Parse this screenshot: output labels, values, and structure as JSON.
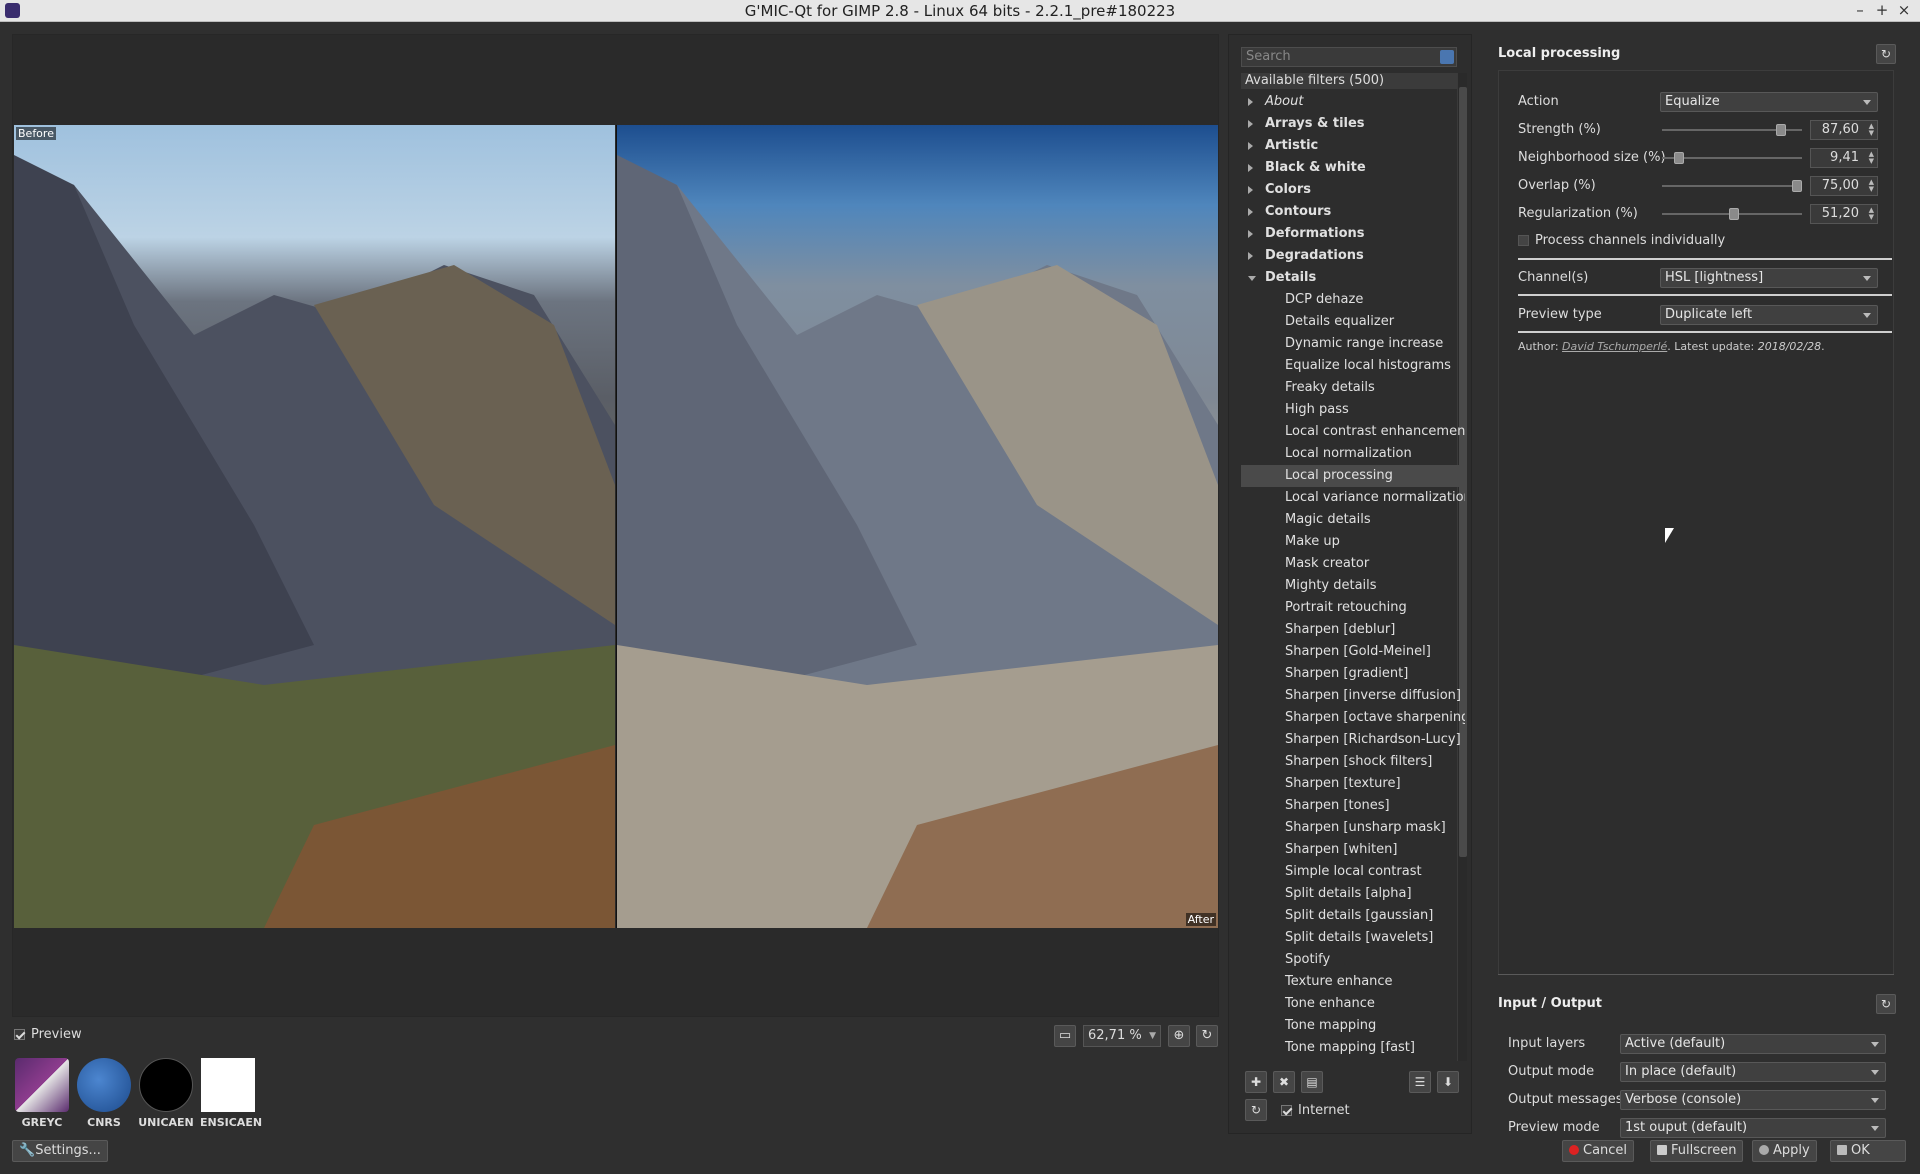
{
  "window": {
    "title": "G'MIC-Qt for GIMP 2.8 - Linux 64 bits - 2.2.1_pre#180223",
    "minimize": "–",
    "maximize": "+",
    "close": "×"
  },
  "preview": {
    "before_label": "Before",
    "after_label": "After",
    "preview_label": "Preview",
    "zoom_value": "62,71 %"
  },
  "logos": [
    {
      "caption": "GREYC",
      "color": "#5a2b6e"
    },
    {
      "caption": "CNRS",
      "color": "#2a5da8"
    },
    {
      "caption": "UNICAEN",
      "color": "#000000"
    },
    {
      "caption": "ENSICAEN",
      "color": "#ffffff"
    }
  ],
  "settings_label": "Settings...",
  "filters": {
    "search_placeholder": "Search",
    "header": "Available filters (500)",
    "categories": [
      "About",
      "Arrays & tiles",
      "Artistic",
      "Black & white",
      "Colors",
      "Contours",
      "Deformations",
      "Degradations",
      "Details"
    ],
    "details_items": [
      "DCP dehaze",
      "Details equalizer",
      "Dynamic range increase",
      "Equalize local histograms",
      "Freaky details",
      "High pass",
      "Local contrast enhancement",
      "Local normalization",
      "Local processing",
      "Local variance normalization",
      "Magic details",
      "Make up",
      "Mask creator",
      "Mighty details",
      "Portrait retouching",
      "Sharpen [deblur]",
      "Sharpen [Gold-Meinel]",
      "Sharpen [gradient]",
      "Sharpen [inverse diffusion]",
      "Sharpen [octave sharpening]",
      "Sharpen [Richardson-Lucy]",
      "Sharpen [shock filters]",
      "Sharpen [texture]",
      "Sharpen [tones]",
      "Sharpen [unsharp mask]",
      "Sharpen [whiten]",
      "Simple local contrast",
      "Split details [alpha]",
      "Split details [gaussian]",
      "Split details [wavelets]",
      "Spotify",
      "Texture enhance",
      "Tone enhance",
      "Tone mapping",
      "Tone mapping [fast]"
    ],
    "selected": "Local processing",
    "internet_label": "Internet"
  },
  "params": {
    "title": "Local processing",
    "action_label": "Action",
    "action_value": "Equalize",
    "strength_label": "Strength (%)",
    "strength_value": "87,60",
    "strength": 87.6,
    "neighborhood_label": "Neighborhood size (%)",
    "neighborhood_value": "9,41",
    "neighborhood": 9.41,
    "overlap_label": "Overlap (%)",
    "overlap_value": "75,00",
    "overlap": 75.0,
    "regularization_label": "Regularization (%)",
    "regularization_value": "51,20",
    "regularization": 51.2,
    "process_channels_label": "Process channels individually",
    "channels_label": "Channel(s)",
    "channels_value": "HSL [lightness]",
    "preview_type_label": "Preview type",
    "preview_type_value": "Duplicate left",
    "author_prefix": "Author:",
    "author_name": "David Tschumperlé",
    "author_update_prefix": ". Latest update:",
    "author_date": "2018/02/28",
    "author_suffix": "."
  },
  "io": {
    "title": "Input / Output",
    "input_layers_label": "Input layers",
    "input_layers_value": "Active (default)",
    "output_mode_label": "Output mode",
    "output_mode_value": "In place (default)",
    "output_messages_label": "Output messages",
    "output_messages_value": "Verbose (console)",
    "preview_mode_label": "Preview mode",
    "preview_mode_value": "1st ouput (default)"
  },
  "buttons": {
    "cancel": "Cancel",
    "fullscreen": "Fullscreen",
    "apply": "Apply",
    "ok": "OK"
  }
}
